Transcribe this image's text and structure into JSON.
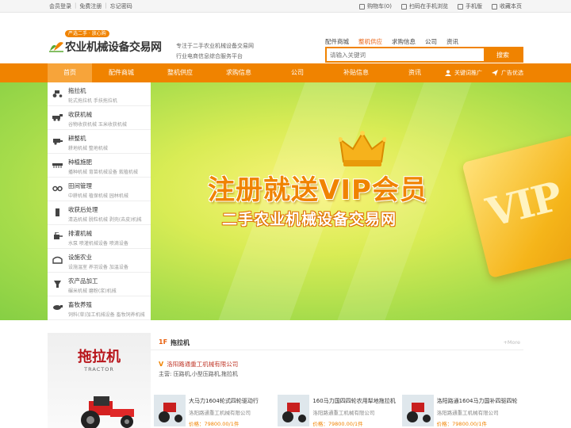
{
  "topbar": {
    "login": "会员登录",
    "register": "免费注册",
    "forgot": "忘记密码",
    "cart": "购物车(0)",
    "mobile_scan": "扫码在手机浏览",
    "mobile": "手机版",
    "bookmark": "收藏本页"
  },
  "header": {
    "logo_badge": "严选二手 · 放心购",
    "logo_name": "农业机械设备交易网",
    "slogan_line1": "专注于二手农业机械设备交易网",
    "slogan_line2": "行业电商信息综合服务平台",
    "quick_links": [
      "配件商城",
      "整机供应",
      "求购信息",
      "公司",
      "资讯"
    ],
    "search_placeholder": "请输入关键词",
    "search_button": "搜索"
  },
  "nav": {
    "items": [
      "首页",
      "配件商城",
      "整机供应",
      "求购信息",
      "公司",
      "补贴信息",
      "资讯"
    ],
    "keyword_promo": "关键词推广",
    "ad_promo": "广告优选"
  },
  "categories": [
    {
      "title": "拖拉机",
      "sub": "轮式拖拉机   手扶拖拉机"
    },
    {
      "title": "收获机械",
      "sub": "谷物收获机械   玉米收获机械"
    },
    {
      "title": "耕整机",
      "sub": "耕地机械   整地机械"
    },
    {
      "title": "种植施肥",
      "sub": "播种机械   育苗机械设备   栽植机械"
    },
    {
      "title": "田间管理",
      "sub": "中耕机械   植保机械   园林机械"
    },
    {
      "title": "收获后处理",
      "sub": "清选机械   脱粒机械   剥壳(去皮)机械"
    },
    {
      "title": "排灌机械",
      "sub": "水泵   喷灌机械设备   喷滴设备"
    },
    {
      "title": "设施农业",
      "sub": "设施温室   养羽设备   加温设备"
    },
    {
      "title": "农产品加工",
      "sub": "碾米机械   磨粉(浆)机械"
    },
    {
      "title": "畜牧养殖",
      "sub": "饲料(草)加工机械设备   畜牧饲养机械"
    }
  ],
  "hero": {
    "headline": "注册就送VIP会员",
    "subline": "二手农业机械设备交易网",
    "card_text": "VIP"
  },
  "floor": {
    "promo_title": "拖拉机",
    "promo_sub": "TRACTOR",
    "number": "1F",
    "title": "拖拉机",
    "more": "+More",
    "company": "洛阳路通重工机械有限公司",
    "main_business": "主营: 压路机,小型压路机,拖拉机",
    "products": [
      {
        "name": "大马力1604轮式四轮驱动行",
        "company": "洛阳路通重工机械有限公司",
        "price": "价格：79800.00/1件"
      },
      {
        "name": "160马力国四四轮农用犁地拖拉机",
        "company": "洛阳路通重工机械有限公司",
        "price": "价格：79800.00/1件"
      },
      {
        "name": "洛阳路通1604马力国补四驱四轮",
        "company": "洛阳路通重工机械有限公司",
        "price": "价格：79800.00/1件"
      }
    ]
  },
  "colors": {
    "brand_orange": "#f08300",
    "accent_red": "#b8151b"
  }
}
